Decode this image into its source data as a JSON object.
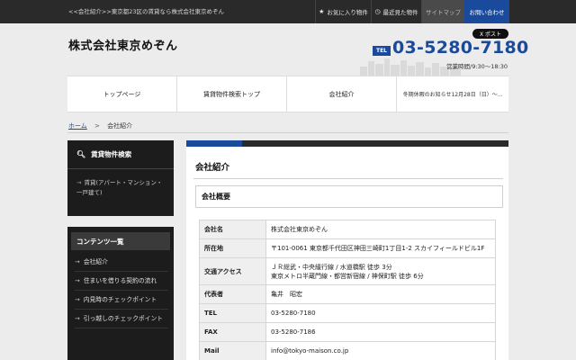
{
  "topbar": {
    "breadcrumb_text": "<<会社紹介>>東京都23区の賃貸なら株式会社東京めぞん",
    "favorites_label": "お気に入り物件",
    "recent_label": "最近見た物件",
    "sitemap_label": "サイトマップ",
    "contact_label": "お問い合わせ",
    "icons": {
      "favorites": "star-icon",
      "recent": "clock-icon"
    }
  },
  "header": {
    "logo": "株式会社東京めぞん",
    "post_button": "X ポスト",
    "tel_badge": "TEL",
    "tel_number": "03-5280-7180",
    "hours": "営業時間/9:30～18:30"
  },
  "nav": {
    "items": [
      "トップページ",
      "賃貸物件検索トップ",
      "会社紹介"
    ],
    "notice": "冬期休暇のお知らせ12月28日（日）～..."
  },
  "breadcrumb": {
    "home": "ホーム",
    "sep": ">",
    "current": "会社紹介"
  },
  "sidebar": {
    "search_title": "賃貸物件検索",
    "search_link": "賃貸(アパート・マンション・一戸建て)",
    "contents_title": "コンテンツ一覧",
    "contents": [
      "会社紹介",
      "住まいを借りる契約の流れ",
      "内見時のチェックポイント",
      "引っ越しのチェックポイント"
    ]
  },
  "main": {
    "title": "会社紹介",
    "section_title": "会社概要",
    "rows": [
      {
        "key": "会社名",
        "value": "株式会社東京めぞん"
      },
      {
        "key": "所在地",
        "value": "〒101-0061 東京都千代田区神田三崎町1丁目1-2 スカイフィールドビル1F"
      },
      {
        "key": "交通アクセス",
        "value": "ＪＲ総武・中央緩行線 / 水道橋駅 徒歩 3分",
        "value2": "東京メトロ半蔵門線・都営新宿線 / 神保町駅 徒歩 6分"
      },
      {
        "key": "代表者",
        "value": "亀井　昭宏"
      },
      {
        "key": "TEL",
        "value": "03-5280-7180"
      },
      {
        "key": "FAX",
        "value": "03-5280-7186"
      },
      {
        "key": "Mail",
        "value": "info@tokyo-maison.co.jp"
      }
    ]
  },
  "colors": {
    "accent": "#1a4a9c",
    "dark": "#1c1c1c",
    "background": "#ececec"
  }
}
